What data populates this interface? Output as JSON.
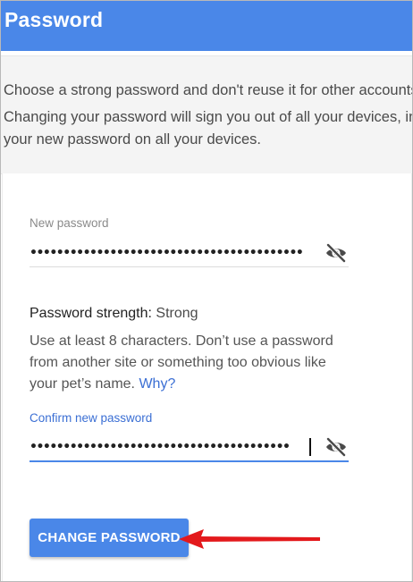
{
  "header": {
    "title": "Password"
  },
  "info": {
    "line1": "Choose a strong password and don't reuse it for other accounts.",
    "line2": "Changing your password will sign you out of all your devices, including your phone. You will need to enter",
    "line3": "your new password on all your devices."
  },
  "form": {
    "new_password": {
      "label": "New password",
      "masked_value": "•••••••••••••••••••••••••••••••••••••••••"
    },
    "confirm_password": {
      "label": "Confirm new password",
      "masked_value": "•••••••••••••••••••••••••••••••••••••••"
    },
    "strength": {
      "label": "Password strength: ",
      "value": "Strong"
    },
    "hint": {
      "line1": "Use at least 8 characters. Don’t use a password",
      "line2": "from another site or something too obvious like",
      "line3_prefix": "your pet’s name. ",
      "why_link": "Why?"
    },
    "submit_label": "CHANGE PASSWORD"
  },
  "icons": {
    "visibility_toggle": "eye-off-icon",
    "annotation": "red-arrow-icon"
  },
  "colors": {
    "accent": "#4a87e8",
    "link": "#3b6fd4",
    "annotation": "#e3191c"
  }
}
